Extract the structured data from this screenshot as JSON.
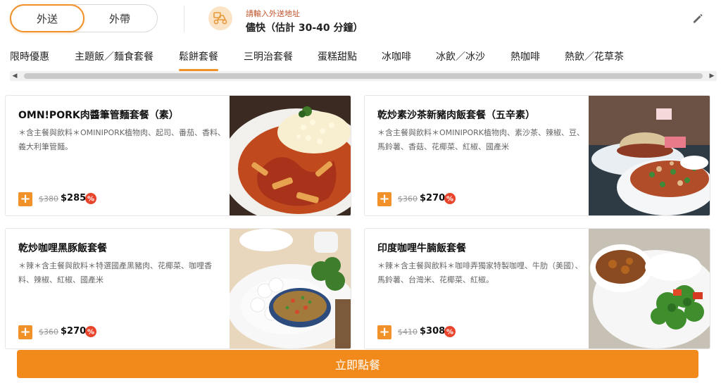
{
  "mode": {
    "delivery_label": "外送",
    "pickup_label": "外帶"
  },
  "address": {
    "prompt": "請輸入外送地址",
    "eta": "儘快（估計 30-40 分鐘）"
  },
  "tabs": [
    {
      "label": "限時優惠"
    },
    {
      "label": "主題飯／麵食套餐"
    },
    {
      "label": "鬆餅套餐"
    },
    {
      "label": "三明治套餐"
    },
    {
      "label": "蛋糕甜點"
    },
    {
      "label": "冰咖啡"
    },
    {
      "label": "冰飲／冰沙"
    },
    {
      "label": "熱咖啡"
    },
    {
      "label": "熱飲／花草茶"
    }
  ],
  "active_tab": "鬆餅套餐",
  "products": [
    {
      "name": "OMN!PORK肉醬筆管麵套餐（素）",
      "desc": "＊含主餐與飲料＊OMINIPORK植物肉、起司、番茄、香料、義大利筆管麵。",
      "old_price": "$380",
      "price": "$285",
      "image": "pasta-dish"
    },
    {
      "name": "乾炒素沙茶新豬肉飯套餐（五辛素）",
      "desc": "＊含主餐與飲料＊OMINIPORK植物肉、素沙茶、辣椒、豆、馬鈴薯、香菇、花椰菜、紅椒、國產米",
      "old_price": "$360",
      "price": "$270",
      "image": "rice-bowl-dish"
    },
    {
      "name": "乾炒咖哩黑豚飯套餐",
      "desc": "＊辣＊含主餐與飲料＊特選國產黑豬肉、花椰菜、咖哩香料、辣椒、紅椒、國產米",
      "old_price": "$360",
      "price": "$270",
      "image": "curry-pork-rice-dish"
    },
    {
      "name": "印度咖哩牛腩飯套餐",
      "desc": "＊辣＊含主餐與飲料＊咖啡弄獨家特製咖哩、牛肋（美國）、馬鈴薯、台灣米、花椰菜、紅椒。",
      "old_price": "$410",
      "price": "$308",
      "image": "beef-curry-dish"
    }
  ],
  "order_button": "立即點餐",
  "colors": {
    "accent": "#f0912a",
    "sale_badge": "#e8452c"
  }
}
